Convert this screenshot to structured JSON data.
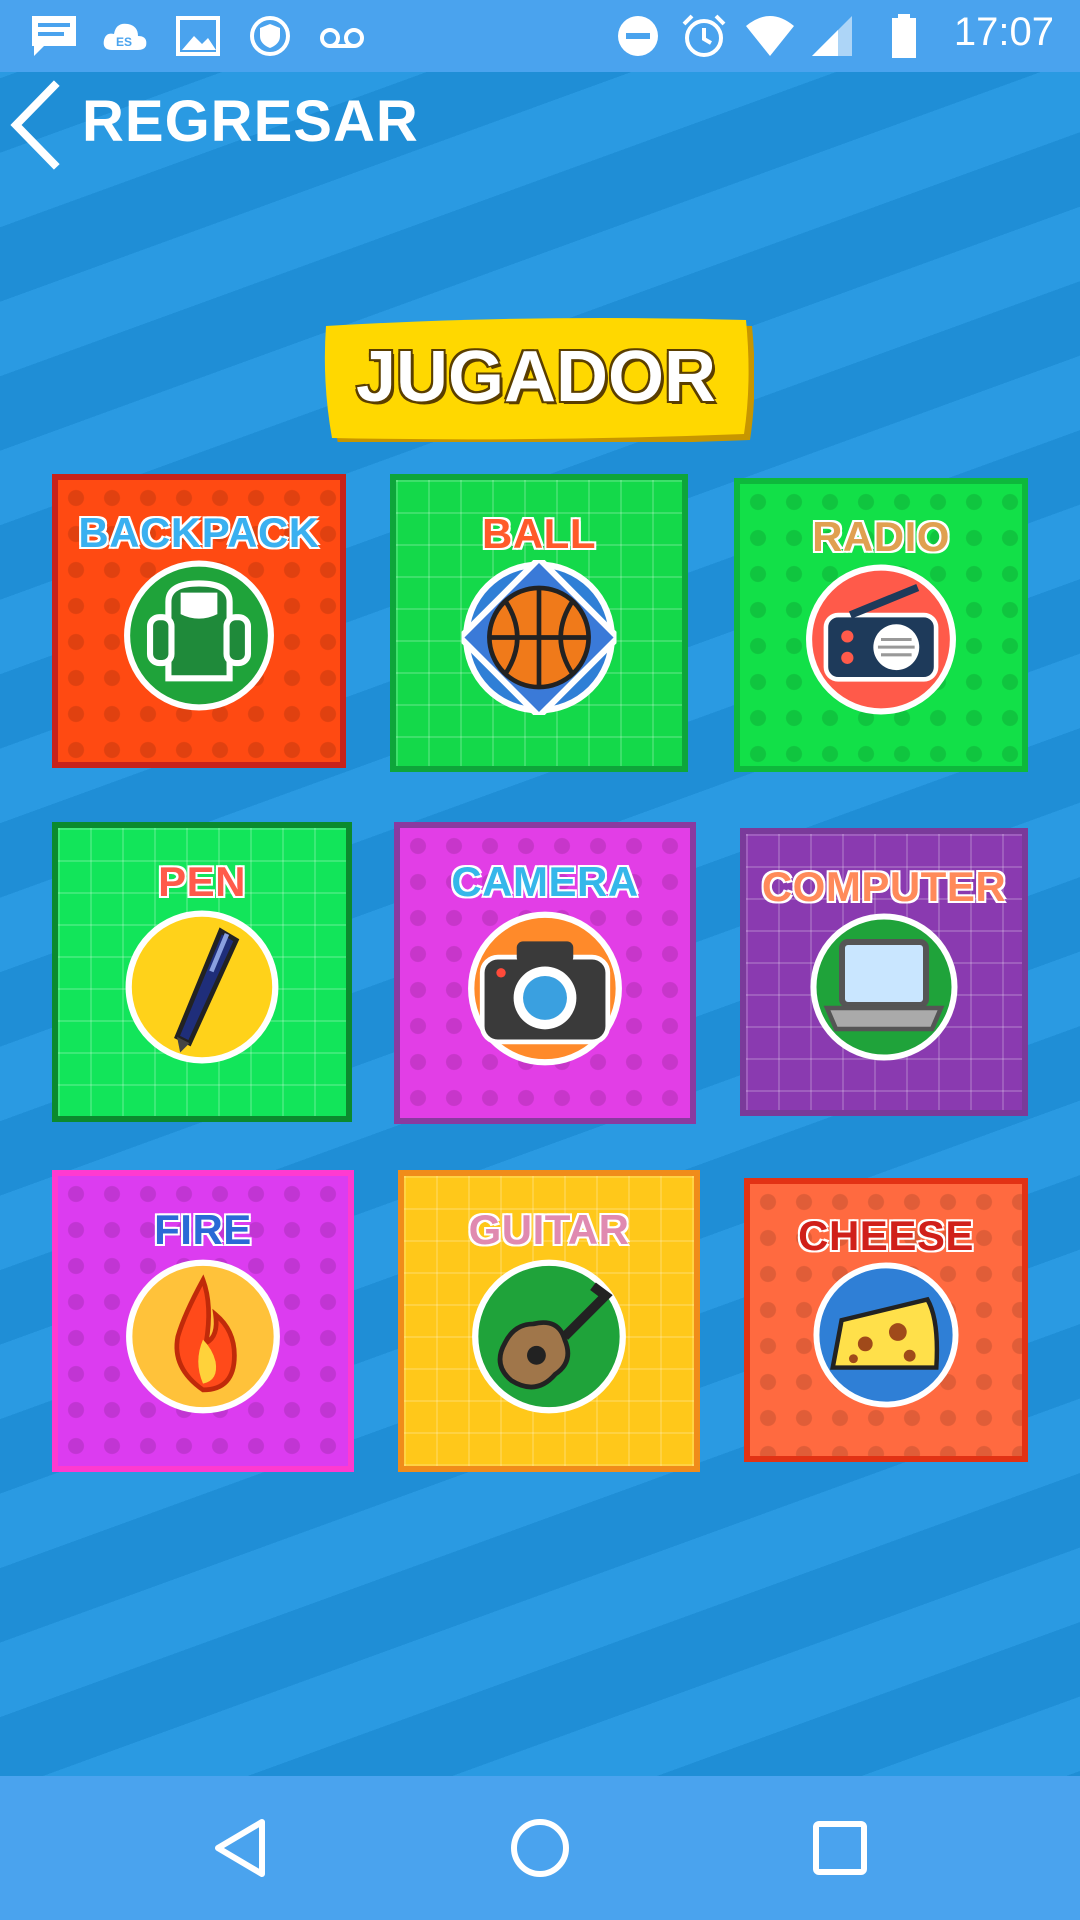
{
  "status_bar": {
    "time": "17:07",
    "left_icons": [
      "message-icon",
      "cloud-icon",
      "image-icon",
      "shield-icon",
      "voicemail-icon"
    ],
    "right_icons": [
      "do-not-disturb-icon",
      "alarm-icon",
      "wifi-icon",
      "signal-icon",
      "battery-icon"
    ]
  },
  "header": {
    "back_label": "REGRESAR"
  },
  "title": "JUGADOR",
  "tiles": [
    {
      "label": "BACKPACK",
      "icon": "backpack-icon",
      "bg": "#ff4a12",
      "border": "#c8221a",
      "label_color": "#3ab0f0",
      "circle": "#1fa33a"
    },
    {
      "label": "BALL",
      "icon": "basketball-icon",
      "bg": "#14d94a",
      "border": "#0ea53a",
      "label_color": "#ff5a2a",
      "circle": "#2f7fd6"
    },
    {
      "label": "RADIO",
      "icon": "radio-icon",
      "bg": "#12e048",
      "border": "#0eb83c",
      "label_color": "#e0a050",
      "circle": "#ff5a4a"
    },
    {
      "label": "PEN",
      "icon": "pen-icon",
      "bg": "#12e55a",
      "border": "#0b8a2e",
      "label_color": "#ff5a4a",
      "circle": "#ffd21a"
    },
    {
      "label": "CAMERA",
      "icon": "camera-icon",
      "bg": "#e23ee6",
      "border": "#8a3aa0",
      "label_color": "#35b7ea",
      "circle": "#ff8a2a"
    },
    {
      "label": "COMPUTER",
      "icon": "laptop-icon",
      "bg": "#8a3ab0",
      "border": "#7a3a9a",
      "label_color": "#ff8a5a",
      "circle": "#1fa33a"
    },
    {
      "label": "FIRE",
      "icon": "fire-icon",
      "bg": "#dc3cf0",
      "border": "#ff3ad0",
      "label_color": "#2a6ad6",
      "circle": "#ffc23a"
    },
    {
      "label": "GUITAR",
      "icon": "guitar-icon",
      "bg": "#ffc81a",
      "border": "#f08c1a",
      "label_color": "#e08ab0",
      "circle": "#1fa33a"
    },
    {
      "label": "CHEESE",
      "icon": "cheese-icon",
      "bg": "#ff6a40",
      "border": "#e23214",
      "label_color": "#d0201a",
      "circle": "#2f7fd6"
    }
  ],
  "nav_bar": {
    "icons": [
      "back-triangle-icon",
      "home-circle-icon",
      "recents-square-icon"
    ]
  }
}
